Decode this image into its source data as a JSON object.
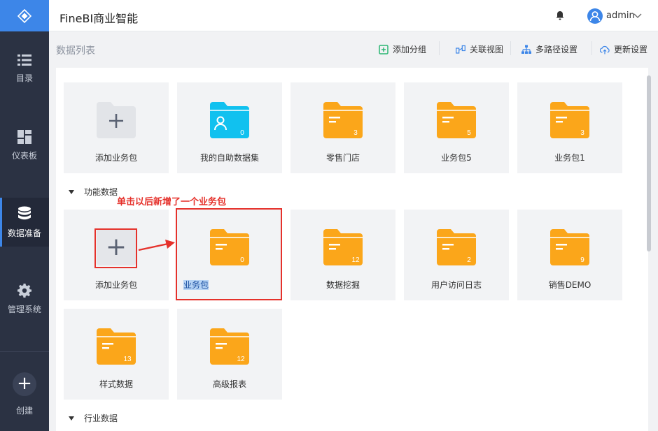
{
  "app": {
    "title": "FineBI商业智能"
  },
  "sidebar": {
    "items": [
      {
        "label": "目录"
      },
      {
        "label": "仪表板"
      },
      {
        "label": "数据准备"
      },
      {
        "label": "管理系统"
      }
    ],
    "create_label": "创建"
  },
  "header": {
    "user": "admin"
  },
  "page": {
    "title": "数据列表"
  },
  "toolbar": [
    {
      "label": "添加分组",
      "icon": "add-group-icon"
    },
    {
      "label": "关联视图",
      "icon": "relation-view-icon"
    },
    {
      "label": "多路径设置",
      "icon": "multi-path-icon"
    },
    {
      "label": "更新设置",
      "icon": "cloud-update-icon"
    }
  ],
  "sections": [
    {
      "title": "",
      "items": [
        {
          "label": "添加业务包",
          "type": "add"
        },
        {
          "label": "我的自助数据集",
          "type": "user-folder",
          "count": "0"
        },
        {
          "label": "零售门店",
          "type": "folder",
          "count": "3"
        },
        {
          "label": "业务包5",
          "type": "folder",
          "count": "5"
        },
        {
          "label": "业务包1",
          "type": "folder",
          "count": "3"
        }
      ]
    },
    {
      "title": "功能数据",
      "items": [
        {
          "label": "添加业务包",
          "type": "add"
        },
        {
          "label": "业务包",
          "type": "folder",
          "count": "0"
        },
        {
          "label": "数据挖掘",
          "type": "folder",
          "count": "12"
        },
        {
          "label": "用户访问日志",
          "type": "folder",
          "count": "2"
        },
        {
          "label": "销售DEMO",
          "type": "folder",
          "count": "9"
        },
        {
          "label": "样式数据",
          "type": "folder",
          "count": "13"
        },
        {
          "label": "高级报表",
          "type": "folder",
          "count": "12"
        }
      ]
    },
    {
      "title": "行业数据",
      "items": []
    }
  ],
  "annotation": {
    "text": "单击以后新增了一个业务包"
  },
  "colors": {
    "folder": "#fba61a",
    "user_folder": "#11c1ef",
    "accent": "#3d86e8",
    "annotation": "#e5312b",
    "sidebar": "#2b3243"
  }
}
